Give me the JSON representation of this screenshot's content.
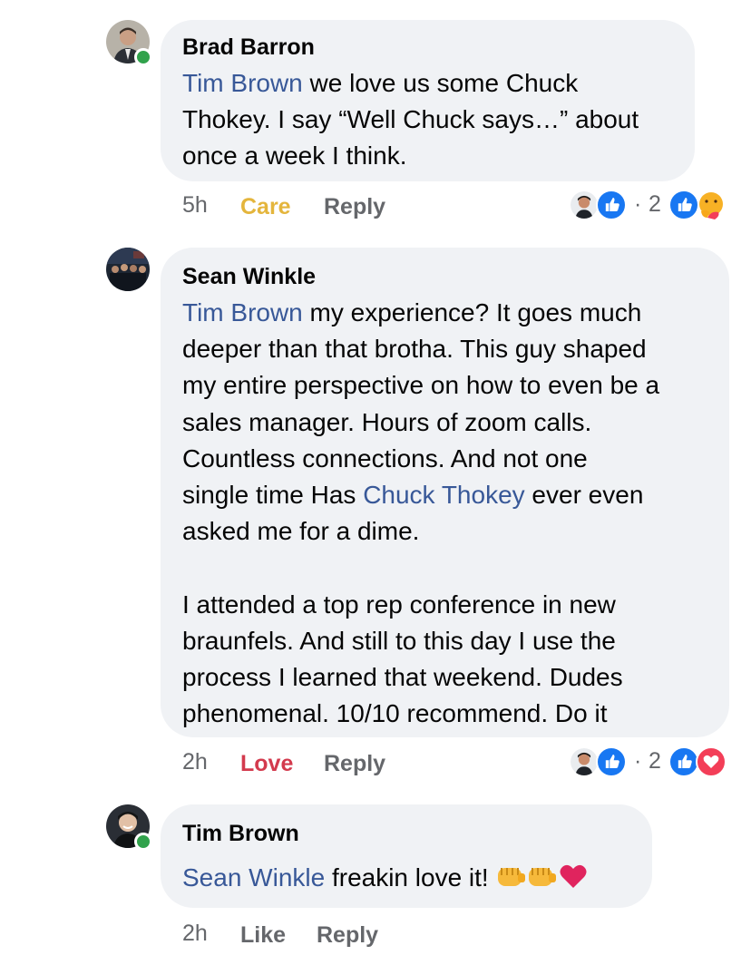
{
  "comments": [
    {
      "author": "Brad Barron",
      "mention": "Tim Brown",
      "text_1": " we love us some Chuck",
      "line_2": "Thokey. I say “Well Chuck says…” about",
      "line_3": "once a week I think.",
      "time": "5h",
      "reaction_label": "Care",
      "reply_label": "Reply",
      "reaction_count_sep": "·",
      "reaction_count": "2",
      "reaction_icons": [
        "like-icon",
        "care-icon"
      ]
    },
    {
      "author": "Sean Winkle",
      "mention": "Tim Brown",
      "text_1": " my experience? It goes much",
      "line_2": "deeper than that brotha. This guy shaped",
      "line_3": "my entire perspective on how to even be a",
      "line_4": "sales manager. Hours of zoom calls.",
      "line_5": "Countless connections. And not one",
      "line_6_pre": "single time Has ",
      "mention_2": "Chuck Thokey",
      "line_6_post": " ever even",
      "line_7": "asked me for a dime.",
      "line_9": "I attended a top rep conference in new",
      "line_10": "braunfels. And still to this day I use the",
      "line_11": "process I learned that weekend. Dudes",
      "line_12": "phenomenal. 10/10 recommend. Do it",
      "time": "2h",
      "reaction_label": "Love",
      "reply_label": "Reply",
      "reaction_count_sep": "·",
      "reaction_count": "2",
      "reaction_icons": [
        "like-icon",
        "love-icon"
      ]
    },
    {
      "author": "Tim Brown",
      "mention": "Sean Winkle",
      "text_1": " freakin love it! ",
      "emoji": [
        "oncoming-fist-emoji",
        "oncoming-fist-emoji",
        "red-heart-emoji"
      ],
      "time": "2h",
      "reaction_label": "Like",
      "reply_label": "Reply"
    }
  ],
  "colors": {
    "bubble": "#f0f2f5",
    "mention": "#385898",
    "care": "#e4b53c",
    "love": "#d33a4d",
    "like_blue": "#1877f2",
    "online": "#31a24c"
  }
}
